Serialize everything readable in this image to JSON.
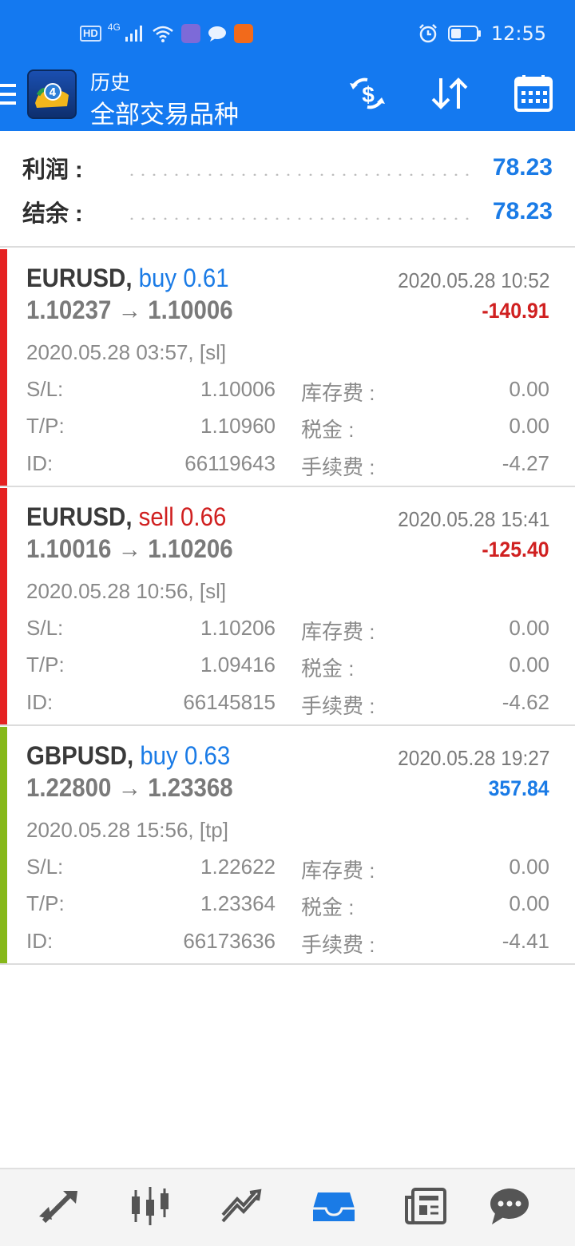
{
  "status_bar": {
    "hd": "HD",
    "network": "4G",
    "time": "12:55"
  },
  "header": {
    "section": "历史",
    "title": "全部交易品种",
    "icons": [
      "deposit-withdraw-icon",
      "sort-icon",
      "calendar-icon"
    ]
  },
  "summary": {
    "profit_label": "利润 :",
    "profit_value": "78.23",
    "balance_label": "结余 :",
    "balance_value": "78.23"
  },
  "trades": [
    {
      "symbol": "EURUSD,",
      "direction": "buy 0.61",
      "prices": "1.10237 → 1.10006",
      "close_time": "2020.05.28 10:52",
      "profit": "-140.91",
      "open_time": "2020.05.28 03:57, [sl]",
      "sl_label": "S/L:",
      "sl": "1.10006",
      "tp_label": "T/P:",
      "tp": "1.10960",
      "id_label": "ID:",
      "id": "66119643",
      "swap_label": "库存费 :",
      "swap": "0.00",
      "tax_label": "税金 :",
      "tax": "0.00",
      "commission_label": "手续费 :",
      "commission": "-4.27",
      "bar_color": "#e52222"
    },
    {
      "symbol": "EURUSD,",
      "direction": "sell 0.66",
      "prices": "1.10016 → 1.10206",
      "close_time": "2020.05.28 15:41",
      "profit": "-125.40",
      "open_time": "2020.05.28 10:56, [sl]",
      "sl_label": "S/L:",
      "sl": "1.10206",
      "tp_label": "T/P:",
      "tp": "1.09416",
      "id_label": "ID:",
      "id": "66145815",
      "swap_label": "库存费 :",
      "swap": "0.00",
      "tax_label": "税金 :",
      "tax": "0.00",
      "commission_label": "手续费 :",
      "commission": "-4.62",
      "bar_color": "#e52222"
    },
    {
      "symbol": "GBPUSD,",
      "direction": "buy 0.63",
      "prices": "1.22800 → 1.23368",
      "close_time": "2020.05.28 19:27",
      "profit": "357.84",
      "open_time": "2020.05.28 15:56, [tp]",
      "sl_label": "S/L:",
      "sl": "1.22622",
      "tp_label": "T/P:",
      "tp": "1.23364",
      "id_label": "ID:",
      "id": "66173636",
      "swap_label": "库存费 :",
      "swap": "0.00",
      "tax_label": "税金 :",
      "tax": "0.00",
      "commission_label": "手续费 :",
      "commission": "-4.41",
      "bar_color": "#86b81a"
    }
  ],
  "bottom_nav": [
    "quotes-icon",
    "chart-icon",
    "trade-icon",
    "history-icon",
    "news-icon",
    "chat-icon"
  ],
  "colors": {
    "primary": "#1479f0",
    "profit_positive": "#1a7be6",
    "profit_negative": "#d02020",
    "active_nav": "#1a7be6"
  }
}
